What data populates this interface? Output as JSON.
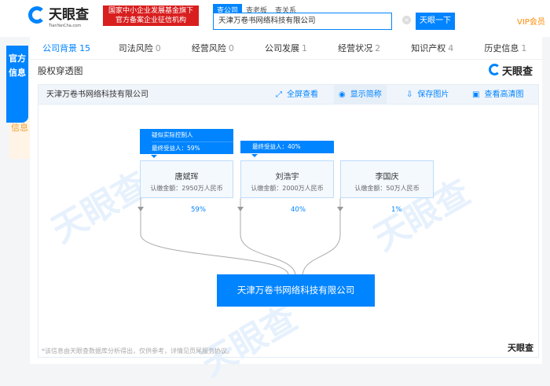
{
  "header": {
    "logo": "天眼查",
    "logo_sub": "TianYanCha.com",
    "badge_line1": "国家中小企业发展基金旗下",
    "badge_line2": "官方备案企业征信机构",
    "search_tabs": [
      "查公司",
      "查老板",
      "查关系"
    ],
    "search_value": "天津万卷书网络科技有限公司",
    "search_button": "天眼一下",
    "vip": "VIP会员"
  },
  "side": {
    "tab1": "官方信息",
    "tab2": "自主信息"
  },
  "tabs": [
    {
      "label": "公司背景",
      "count": "15"
    },
    {
      "label": "司法风险",
      "count": "0"
    },
    {
      "label": "经营风险",
      "count": "0"
    },
    {
      "label": "公司发展",
      "count": "1"
    },
    {
      "label": "经营状况",
      "count": "2"
    },
    {
      "label": "知识产权",
      "count": "4"
    },
    {
      "label": "历史信息",
      "count": "1"
    }
  ],
  "section": {
    "title": "股权穿透图",
    "logo": "天眼查"
  },
  "toolbar": {
    "company": "天津万卷书网络科技有限公司",
    "fullscreen": "全屏查看",
    "show_short": "显示简称",
    "save_image": "保存图片",
    "hd_view": "查看高清图"
  },
  "shareholders": [
    {
      "name": "唐斌珲",
      "amount": "认缴金额：2950万人民币",
      "percent": "59%",
      "tags": [
        "疑似实际控制人",
        "最终受益人：59%"
      ]
    },
    {
      "name": "刘浩宇",
      "amount": "认缴金额：2000万人民币",
      "percent": "40%",
      "tags": [
        "最终受益人：40%"
      ]
    },
    {
      "name": "李国庆",
      "amount": "认缴金额：50万人民币",
      "percent": "1%",
      "tags": []
    }
  ],
  "company": "天津万卷书网络科技有限公司",
  "footer": {
    "note": "*该信息由天眼查数据库分析得出，仅供参考，详情见页尾服务协议。",
    "logo": "天眼查"
  },
  "colors": {
    "accent": "#0084ff",
    "badge": "#d81e1e",
    "vip": "#ff8a00"
  }
}
